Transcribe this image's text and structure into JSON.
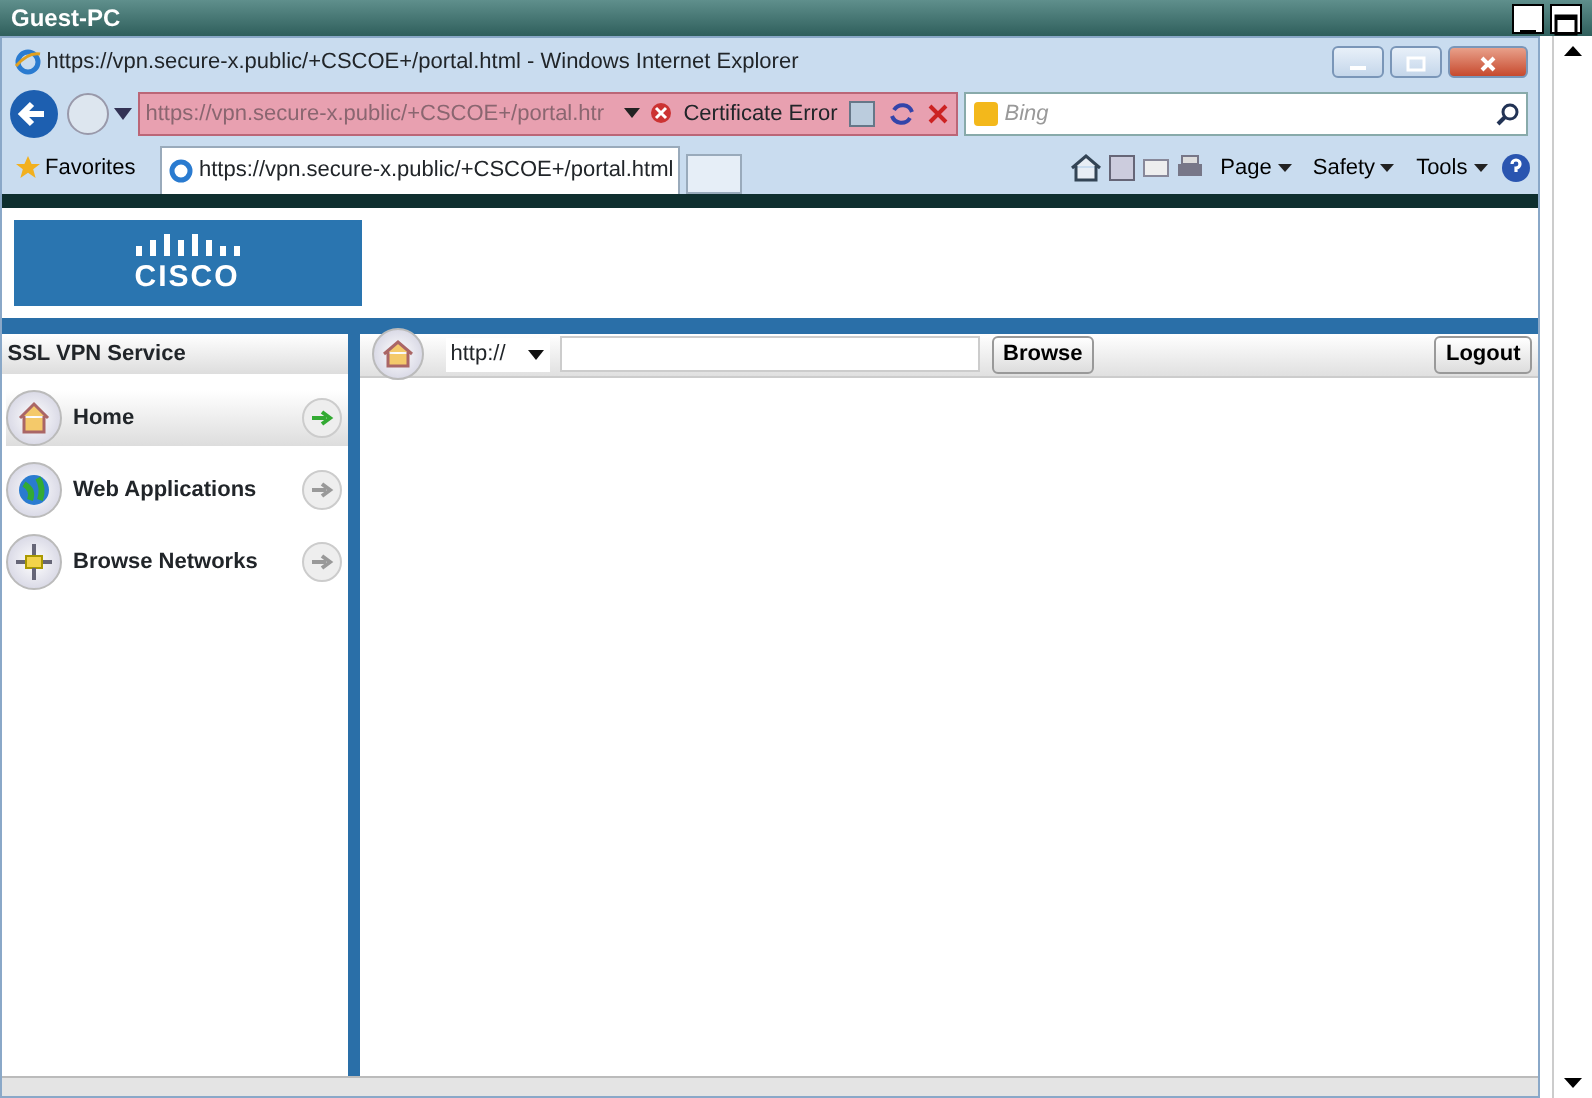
{
  "outer_window": {
    "title": "Guest-PC"
  },
  "browser": {
    "title": "https://vpn.secure-x.public/+CSCOE+/portal.html - Windows Internet Explorer",
    "address": "https://vpn.secure-x.public/+CSCOE+/portal.htr",
    "certificate_error": "Certificate Error",
    "search_placeholder": "Bing",
    "favorites": "Favorites",
    "tab": "https://vpn.secure-x.public/+CSCOE+/portal.html",
    "menus": [
      "Page",
      "Safety",
      "Tools"
    ]
  },
  "portal": {
    "logo": "CISCO",
    "sidebar_title": "SSL VPN Service",
    "nav": [
      {
        "label": "Home",
        "selected": true,
        "kind": "home"
      },
      {
        "label": "Web Applications",
        "selected": false,
        "kind": "globe"
      },
      {
        "label": "Browse Networks",
        "selected": false,
        "kind": "network"
      }
    ],
    "protocol": "http://",
    "browse": "Browse",
    "logout": "Logout"
  }
}
